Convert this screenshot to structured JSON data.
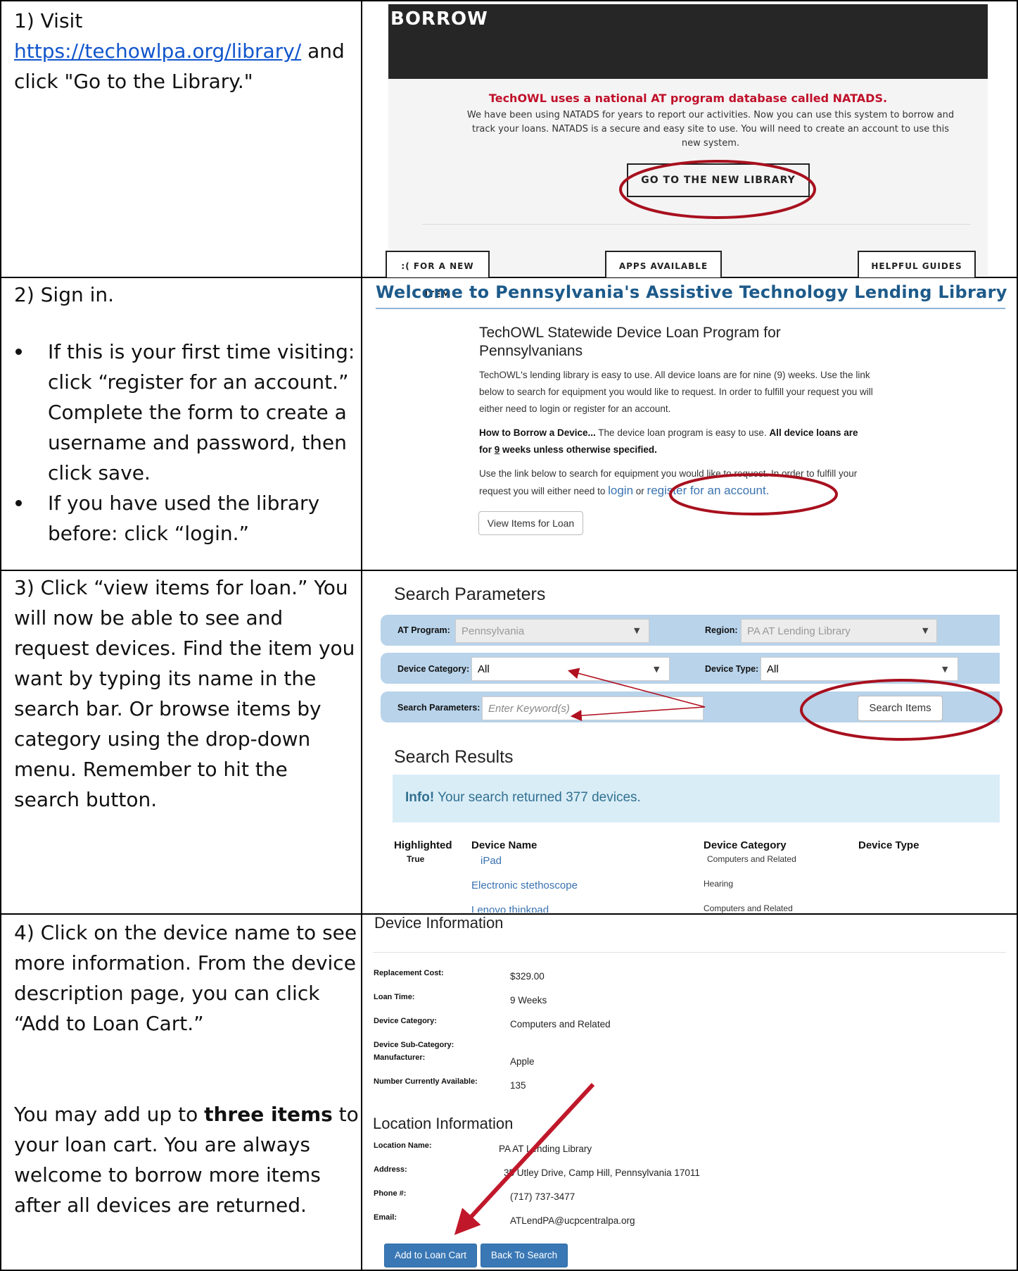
{
  "steps": [
    {
      "text_a": "1) Visit",
      "link": "https://techowlpa.org/library/",
      "text_b": " and click \"Go to the Library.\""
    },
    {
      "intro": "2) Sign in.",
      "bullets": [
        "If this is your first time visiting: click “register for an account.” Complete the form to create a username and password, then click save.",
        "If you have used the library before: click “login.”"
      ]
    },
    {
      "text": "3) Click “view items for loan.” You will now be able to see and request devices. Find the item you want by typing its name in the search bar. Or browse items by category using the drop-down menu. Remember to hit the search button."
    },
    {
      "text_a": "4) Click on the device name to see more information. From the device description page, you can click “Add to Loan Cart.”",
      "text_b_pre": "You may add up to ",
      "text_b_bold": "three items",
      "text_b_post": " to your loan cart. You are always welcome to borrow more items after all devices are returned."
    }
  ],
  "panel1": {
    "header": "BORROW",
    "red_title": "TechOWL uses a national AT program database called NATADS.",
    "desc": "We have been using NATADS for years to report our activities. Now you can use this system to borrow and track your loans. NATADS is a secure and easy site to use. You will need to create an account to use this new system.",
    "button": "GO TO THE NEW LIBRARY",
    "boxes": [
      ":( FOR A NEW ITEM",
      "APPS AVAILABLE",
      "HELPFUL GUIDES"
    ]
  },
  "panel2": {
    "title": "Welcome to Pennsylvania's Assistive Technology Lending Library",
    "subtitle": "TechOWL Statewide Device Loan Program for Pennsylvanians",
    "para1": "TechOWL's lending library is easy to use. All device loans are for nine (9) weeks. Use the link below to search for equipment you would like to request. In order to fulfill your request you will either need to login or register for an account.",
    "para2_b1": "How to Borrow a Device...",
    "para2_mid": " The device loan program is easy to use. ",
    "para2_b2": "All device loans are for ",
    "para2_u": "9",
    "para2_b3": " weeks unless otherwise specified.",
    "para3": "Use the link below to search for equipment you would like to request. In order to fulfill your request you will either need to ",
    "login": "login",
    "or": " or ",
    "register": "register for an account.",
    "view_button": "View Items for Loan"
  },
  "panel3": {
    "search_heading": "Search Parameters",
    "at_program_label": "AT Program:",
    "at_program_value": "Pennsylvania",
    "region_label": "Region:",
    "region_value": "PA AT Lending Library",
    "device_category_label": "Device Category:",
    "device_category_value": "All",
    "device_type_label": "Device Type:",
    "device_type_value": "All",
    "search_params_label": "Search Parameters:",
    "search_placeholder": "Enter Keyword(s)",
    "search_button": "Search Items",
    "results_heading": "Search Results",
    "info_bold": "Info!",
    "info_text": " Your search returned 377 devices.",
    "columns": [
      "Highlighted",
      "Device Name",
      "Device Category",
      "Device Type"
    ],
    "rows": [
      {
        "highlighted": "True",
        "name": "iPad",
        "category": "Computers and Related"
      },
      {
        "highlighted": "",
        "name": "Electronic stethoscope",
        "category": "Hearing"
      },
      {
        "highlighted": "",
        "name": "Lenovo thinkpad",
        "category": "Computers and Related"
      }
    ]
  },
  "panel4": {
    "device_heading": "Device Information",
    "fields": [
      {
        "label": "Replacement Cost:",
        "value": "$329.00"
      },
      {
        "label": "Loan Time:",
        "value": "9 Weeks"
      },
      {
        "label": "Device Category:",
        "value": "Computers and Related"
      },
      {
        "label": "Device Sub-Category:",
        "value": ""
      },
      {
        "label": "Manufacturer:",
        "value": "Apple"
      },
      {
        "label": "Number Currently Available:",
        "value": "135"
      }
    ],
    "location_heading": "Location Information",
    "location_fields": [
      {
        "label": "Location Name:",
        "value": "PA AT Lending Library"
      },
      {
        "label": "Address:",
        "value": "35 Utley Drive, Camp Hill, Pennsylvania 17011"
      },
      {
        "label": "Phone #:",
        "value": "(717) 737-3477"
      },
      {
        "label": "Email:",
        "value": "ATLendPA@ucpcentralpa.org"
      }
    ],
    "add_button": "Add to Loan Cart",
    "back_button": "Back To Search"
  },
  "colors": {
    "annotation_red": "#b01020",
    "link_blue": "#3a73b0",
    "panel_blue": "#b8d3ea",
    "button_blue": "#3a78b5"
  }
}
